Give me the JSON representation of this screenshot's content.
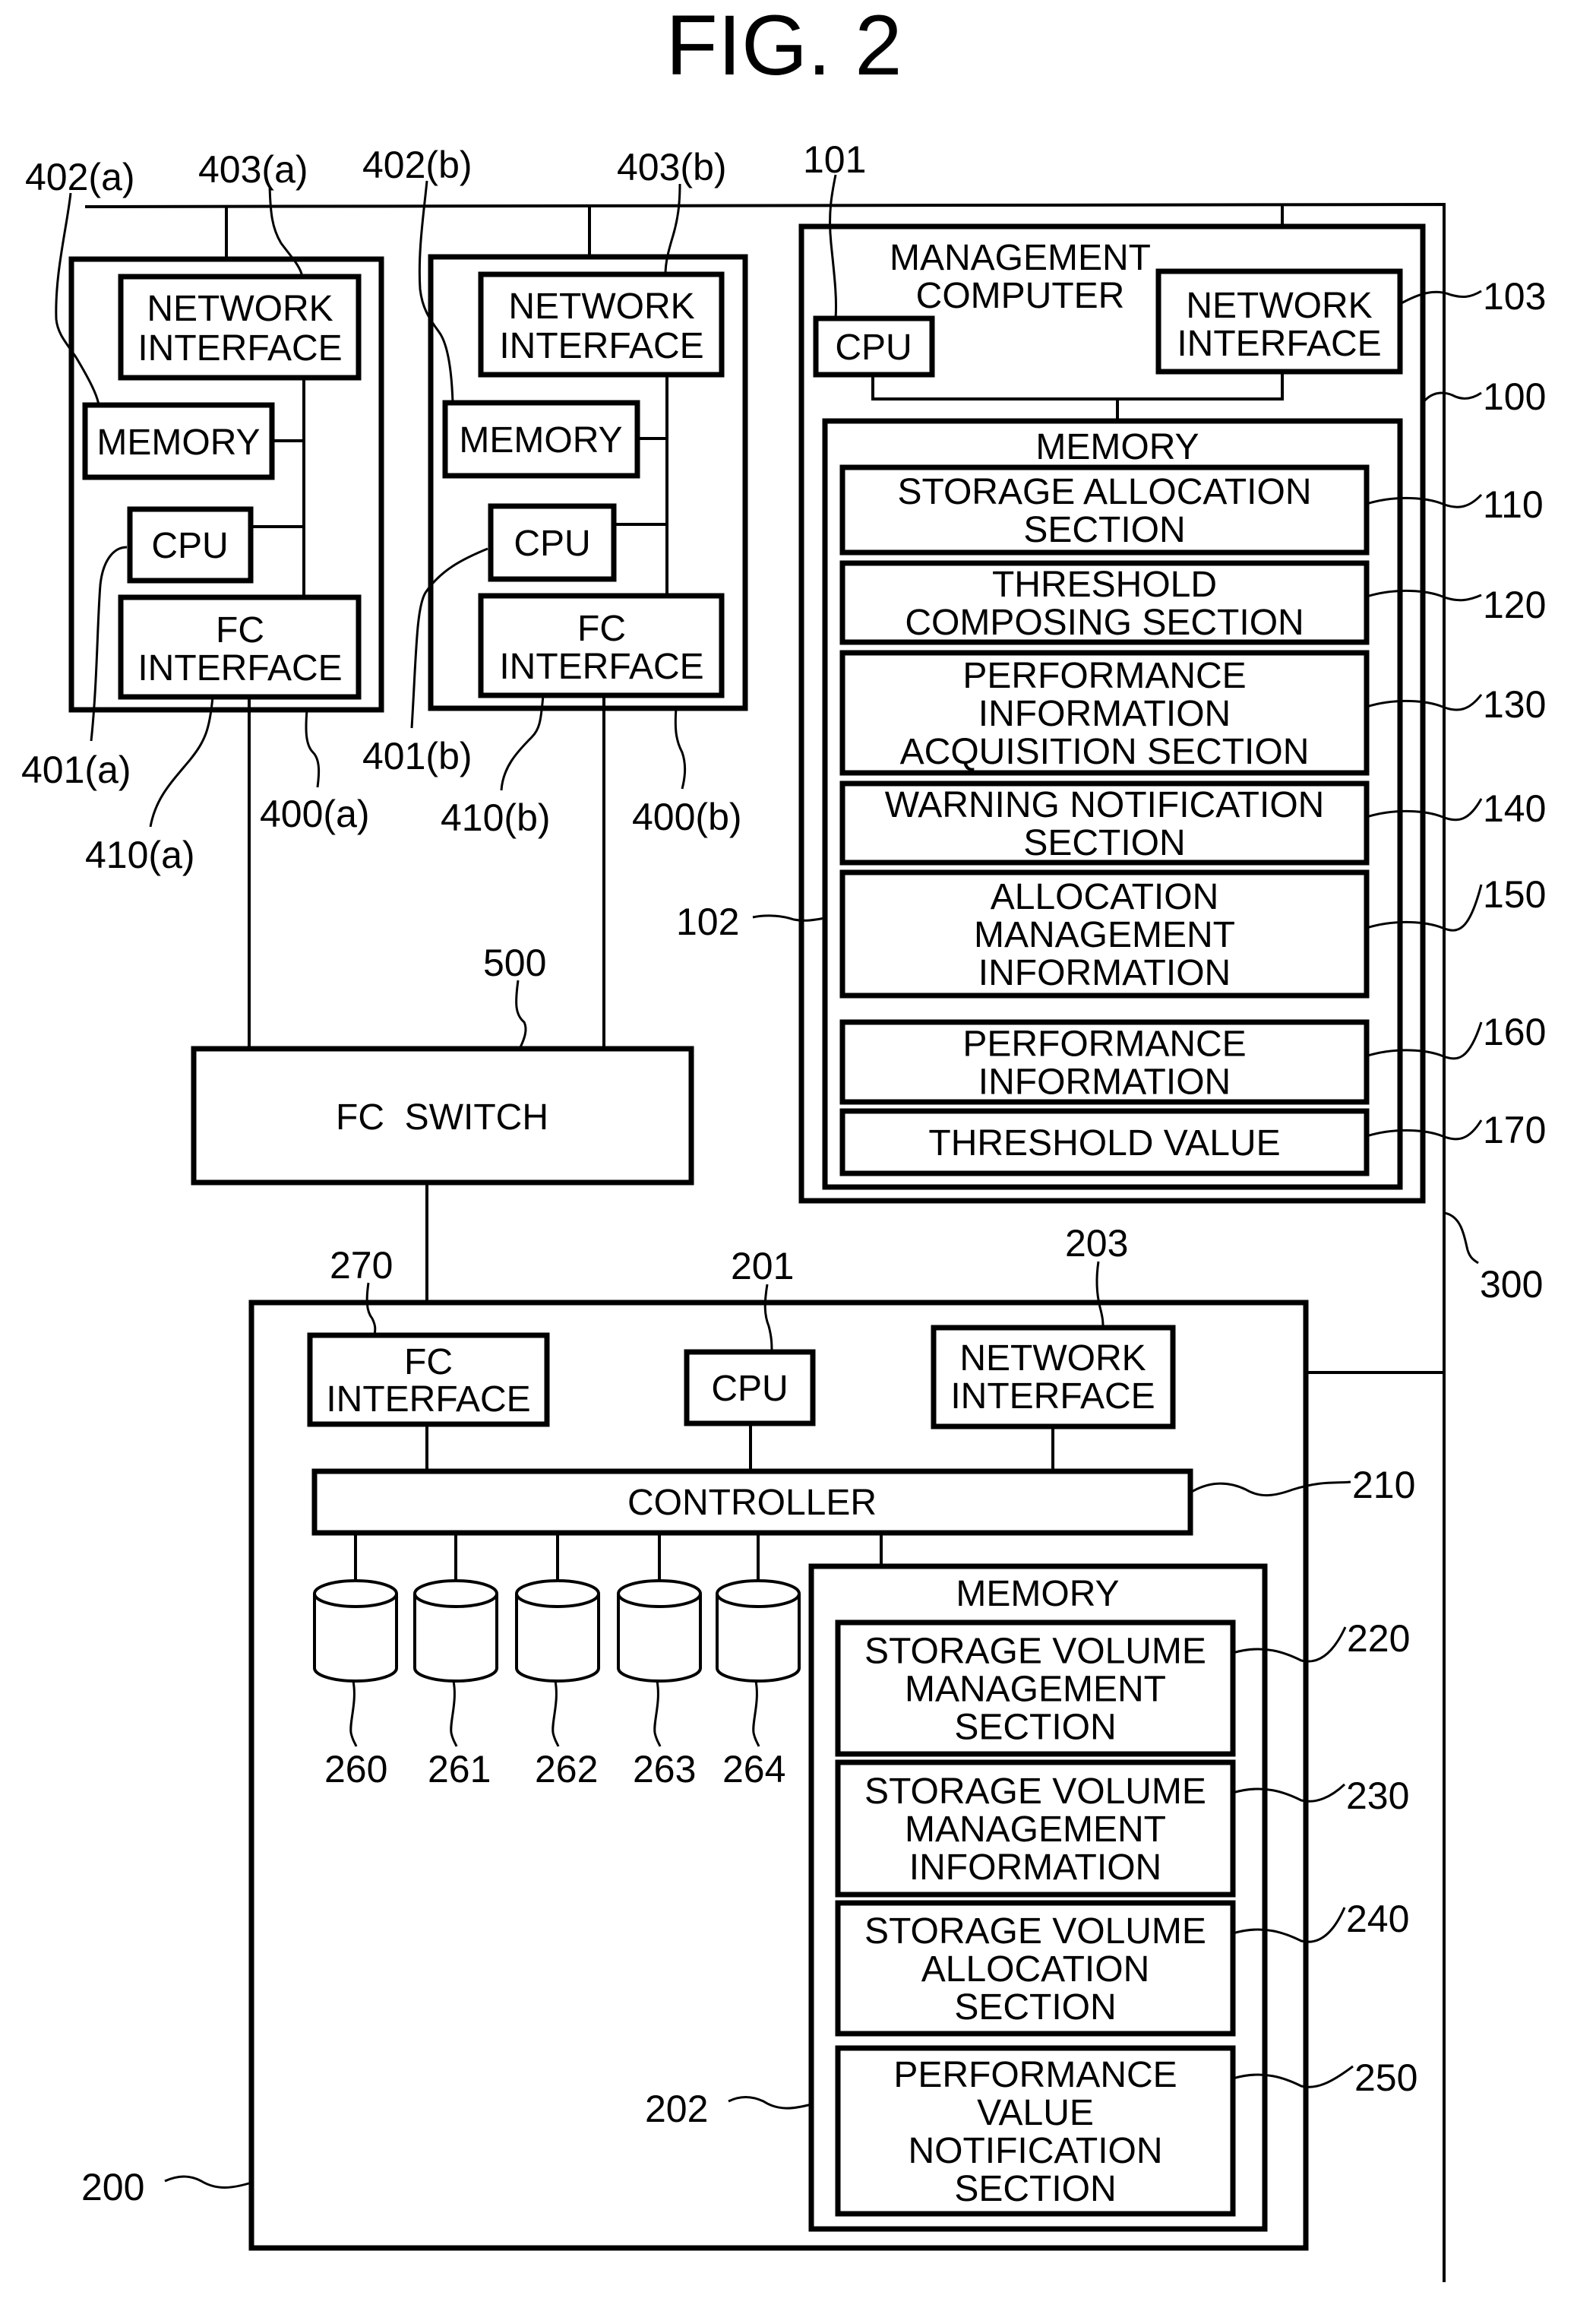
{
  "figure": {
    "title": "FIG. 2"
  },
  "hosts": [
    {
      "id": "400(a)",
      "ref_host": "400(a)",
      "network_interface": {
        "label": [
          "NETWORK",
          "INTERFACE"
        ],
        "ref": "403(a)"
      },
      "memory": {
        "label": [
          "MEMORY"
        ],
        "ref": "402(a)"
      },
      "cpu": {
        "label": [
          "CPU"
        ],
        "ref": "401(a)"
      },
      "fc_interface": {
        "label": [
          "FC",
          "INTERFACE"
        ],
        "ref": "410(a)"
      }
    },
    {
      "id": "400(b)",
      "ref_host": "400(b)",
      "network_interface": {
        "label": [
          "NETWORK",
          "INTERFACE"
        ],
        "ref": "403(b)"
      },
      "memory": {
        "label": [
          "MEMORY"
        ],
        "ref": "402(b)"
      },
      "cpu": {
        "label": [
          "CPU"
        ],
        "ref": "401(b)"
      },
      "fc_interface": {
        "label": [
          "FC",
          "INTERFACE"
        ],
        "ref": "410(b)"
      }
    }
  ],
  "fc_switch": {
    "label": "FC  SWITCH",
    "ref": "500"
  },
  "management_computer": {
    "title": [
      "MANAGEMENT",
      "COMPUTER"
    ],
    "ref": "100",
    "cpu": {
      "label": "CPU",
      "ref": "101"
    },
    "network_interface": {
      "label": [
        "NETWORK",
        "INTERFACE"
      ],
      "ref": "103"
    },
    "memory": {
      "label": "MEMORY",
      "ref": "102",
      "sections": [
        {
          "label": [
            "STORAGE  ALLOCATION",
            "SECTION"
          ],
          "ref": "110"
        },
        {
          "label": [
            "THRESHOLD",
            "COMPOSING  SECTION"
          ],
          "ref": "120"
        },
        {
          "label": [
            "PERFORMANCE",
            "INFORMATION",
            "ACQUISITION  SECTION"
          ],
          "ref": "130"
        },
        {
          "label": [
            "WARNING  NOTIFICATION",
            "SECTION"
          ],
          "ref": "140"
        },
        {
          "label": [
            "ALLOCATION",
            "MANAGEMENT",
            "INFORMATION"
          ],
          "ref": "150"
        },
        {
          "label": [
            "PERFORMANCE",
            "INFORMATION"
          ],
          "ref": "160"
        },
        {
          "label": [
            "THRESHOLD  VALUE"
          ],
          "ref": "170"
        }
      ]
    }
  },
  "network": {
    "ref": "300"
  },
  "storage": {
    "ref": "200",
    "fc_interface": {
      "label": [
        "FC",
        "INTERFACE"
      ],
      "ref": "270"
    },
    "cpu": {
      "label": "CPU",
      "ref": "201"
    },
    "network_interface": {
      "label": [
        "NETWORK",
        "INTERFACE"
      ],
      "ref": "203"
    },
    "controller": {
      "label": "CONTROLLER",
      "ref": "210"
    },
    "disks": [
      {
        "ref": "260"
      },
      {
        "ref": "261"
      },
      {
        "ref": "262"
      },
      {
        "ref": "263"
      },
      {
        "ref": "264"
      }
    ],
    "memory": {
      "label": "MEMORY",
      "ref": "202",
      "sections": [
        {
          "label": [
            "STORAGE  VOLUME",
            "MANAGEMENT",
            "SECTION"
          ],
          "ref": "220"
        },
        {
          "label": [
            "STORAGE  VOLUME",
            "MANAGEMENT",
            "INFORMATION"
          ],
          "ref": "230"
        },
        {
          "label": [
            "STORAGE  VOLUME",
            "ALLOCATION",
            "SECTION"
          ],
          "ref": "240"
        },
        {
          "label": [
            "PERFORMANCE",
            "VALUE",
            "NOTIFICATION",
            "SECTION"
          ],
          "ref": "250"
        }
      ]
    }
  }
}
